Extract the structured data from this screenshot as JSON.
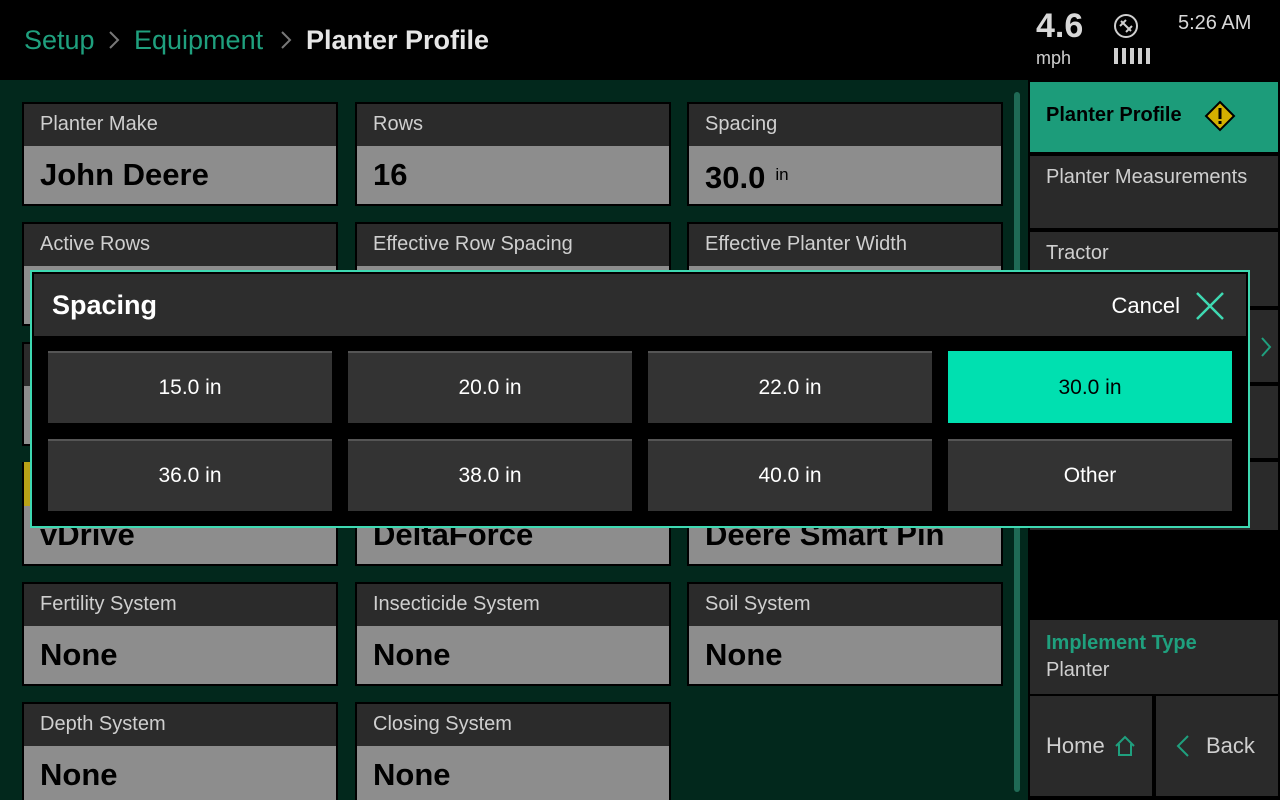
{
  "breadcrumb": {
    "setup": "Setup",
    "equipment": "Equipment",
    "current": "Planter Profile"
  },
  "status": {
    "speed": "4.6",
    "speed_unit": "mph",
    "time": "5:26 AM"
  },
  "fields": {
    "planter_make": {
      "label": "Planter Make",
      "value": "John Deere"
    },
    "rows": {
      "label": "Rows",
      "value": "16"
    },
    "spacing": {
      "label": "Spacing",
      "value": "30.0",
      "unit": "in"
    },
    "active_rows": {
      "label": "Active Rows"
    },
    "effective_row_spacing": {
      "label": "Effective Row Spacing"
    },
    "effective_planter_width": {
      "label": "Effective Planter Width"
    },
    "drive_value": "vDrive",
    "downforce_value": "DeltaForce",
    "pin_value": "Deere Smart Pin",
    "fertility": {
      "label": "Fertility System",
      "value": "None"
    },
    "insecticide": {
      "label": "Insecticide System",
      "value": "None"
    },
    "soil": {
      "label": "Soil System",
      "value": "None"
    },
    "depth": {
      "label": "Depth System",
      "value": "None"
    },
    "closing": {
      "label": "Closing System",
      "value": "None"
    }
  },
  "sidebar": {
    "planter_profile": "Planter Profile",
    "planter_measurements": "Planter Measurements",
    "tractor": "Tractor",
    "implement_type_label": "Implement Type",
    "implement_type_value": "Planter",
    "home": "Home",
    "back": "Back"
  },
  "modal": {
    "title": "Spacing",
    "cancel": "Cancel",
    "options": [
      "15.0 in",
      "20.0 in",
      "22.0 in",
      "30.0 in",
      "36.0 in",
      "38.0 in",
      "40.0 in",
      "Other"
    ],
    "selected": "30.0 in"
  },
  "colors": {
    "accent": "#00e0b0",
    "brand_green": "#1fa07e",
    "warning": "#d4b000"
  }
}
